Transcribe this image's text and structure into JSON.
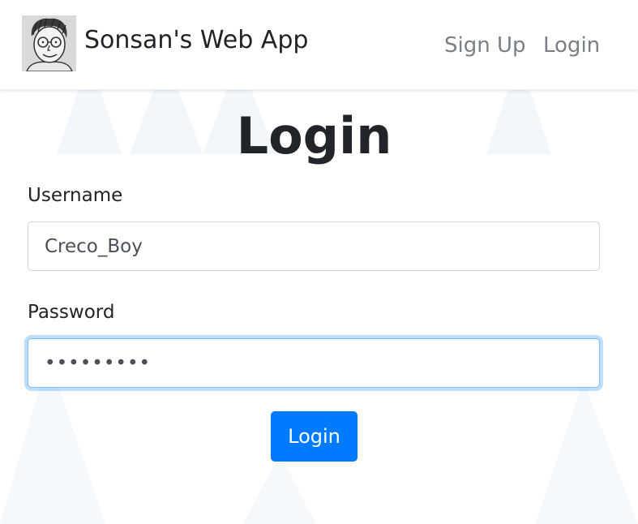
{
  "navbar": {
    "brand": "Sonsan's Web App",
    "links": [
      {
        "label": "Sign Up"
      },
      {
        "label": "Login"
      }
    ]
  },
  "page": {
    "title": "Login"
  },
  "form": {
    "username": {
      "label": "Username",
      "value": "Creco_Boy"
    },
    "password": {
      "label": "Password",
      "value": "•••••••••"
    },
    "submit_label": "Login"
  },
  "colors": {
    "primary": "#007bff",
    "text": "#212529",
    "nav_link": "#7a7f85",
    "focus_ring": "#80bdff"
  }
}
